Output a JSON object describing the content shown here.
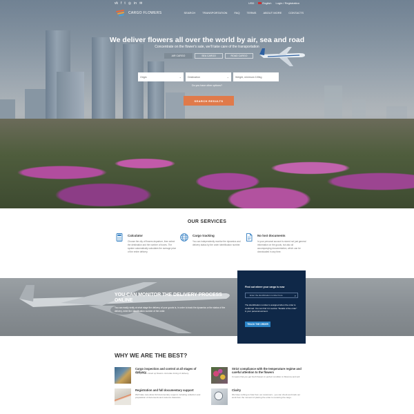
{
  "colors": {
    "accent_orange": "#e07a4a",
    "navy_panel": "#0f2848",
    "track_button": "#2a83c6"
  },
  "topbar": {
    "social_icons": [
      "vk-icon",
      "facebook-icon",
      "twitter-icon",
      "instagram-icon",
      "linkedin-icon",
      "mail-icon"
    ],
    "currency": "USD",
    "language": "English",
    "auth": "Login / Registration"
  },
  "header": {
    "logo_text": "CARGO FLOWERS",
    "nav": [
      "SEARCH",
      "TRANSPORTATION",
      "FAQ",
      "TERMS",
      "ABOUT MORE",
      "CONTACTS"
    ]
  },
  "hero": {
    "headline": "We deliver flowers all over the world by air, sea and road",
    "subline": "Concentrate on the flower's sale, we'll take care of the transportation",
    "tabs": [
      "AIR CARGO",
      "SEA CARGO",
      "ROAD CARGO"
    ],
    "active_tab": "AIR CARGO",
    "fields": {
      "origin": "Origin",
      "destination": "Destination",
      "weight": "Weight, minimum 100kg"
    },
    "other_options": "Do you have other options?",
    "search_button": "SEARCH RESULTS"
  },
  "services": {
    "title": "OUR SERVICES",
    "items": [
      {
        "title": "Calculator",
        "text": "Choose the city of flowers departure, then select the destination and the number of boxes. The system automatically calculates the average price of the entire delivery.",
        "icon": "calculator-icon"
      },
      {
        "title": "Cargo tracking",
        "text": "You can independently monitor the dynamics and delivery status by the order identification number.",
        "icon": "globe-icon"
      },
      {
        "title": "No lost documents",
        "text": "In your personal account is stored not just general information on the goods, but also all accompanying documentation, which can be downloaded in any time.",
        "icon": "document-icon"
      }
    ]
  },
  "monitor": {
    "title": "YOU CAN MONITOR THE DELIVERY PROCESS ONLINE",
    "text": "You can easily verify at what stage the delivery of your goods is, in order to track the dynamics or the status of the delivery, enter the identification number of the order."
  },
  "track": {
    "title": "Find out where your cargo is now",
    "placeholder": "Enter the identification number here",
    "text": "The identification number is assigned when the order is confirmed. You can find it in section \"Details of the order\" in your personal account.",
    "button": "TRACK THE ORDER"
  },
  "why": {
    "title": "WHY WE ARE THE BEST?",
    "items": [
      {
        "title": "Cargo inspection and control at all stages of delivery",
        "text": "You spend in mixed up flowers. Accurate timing of delivery."
      },
      {
        "title": "Strict compliance with the temperature regime and careful attention to the flowers",
        "text": "It means that you get fresh flowers in perfect condition in Moscow and sell."
      },
      {
        "title": "Registration and full documentary support",
        "text": "We'll take care about full documentary support, including collection and preparation of documents and customs clearance."
      },
      {
        "title": "Clarity",
        "text": "We have nothing to hide from our customers - you can check and track our work from the moment of placing the order to receiving the cargo."
      }
    ]
  }
}
